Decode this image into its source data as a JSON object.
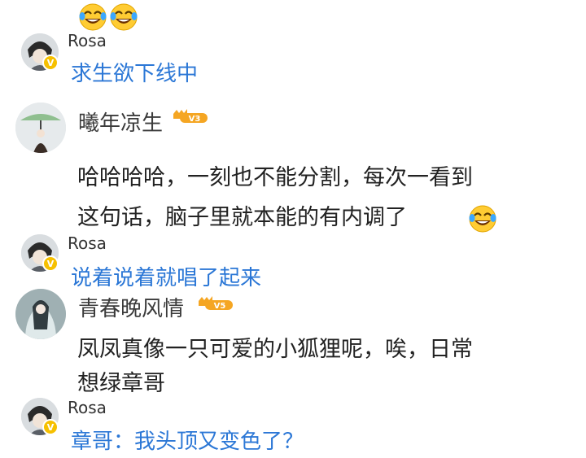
{
  "threads": [
    {
      "reply_user": "Rosa",
      "reply_text": "求生欲下线中"
    },
    {
      "user": "曦年凉生",
      "level": "V3",
      "comment_lines": [
        "哈哈哈哈，一刻也不能分割，每次一看到",
        "这句话，脑子里就本能的有内调了"
      ],
      "reply_user": "Rosa",
      "reply_text": "说着说着就唱了起来"
    },
    {
      "user": "青春晚风情",
      "level": "V5",
      "comment_lines": [
        "凤凤真像一只可爱的小狐狸呢，唉，日常",
        "想绿章哥"
      ],
      "reply_user": "Rosa",
      "reply_text": "章哥：我头顶又变色了？"
    }
  ],
  "icons": {
    "emoji": "laugh-cry-emoji-icon",
    "verified": "v-badge-icon"
  },
  "colors": {
    "reply_blue": "#2b77d6",
    "text": "#222222",
    "verified_yellow": "#f6c000",
    "level_gold": "#f5a623"
  }
}
